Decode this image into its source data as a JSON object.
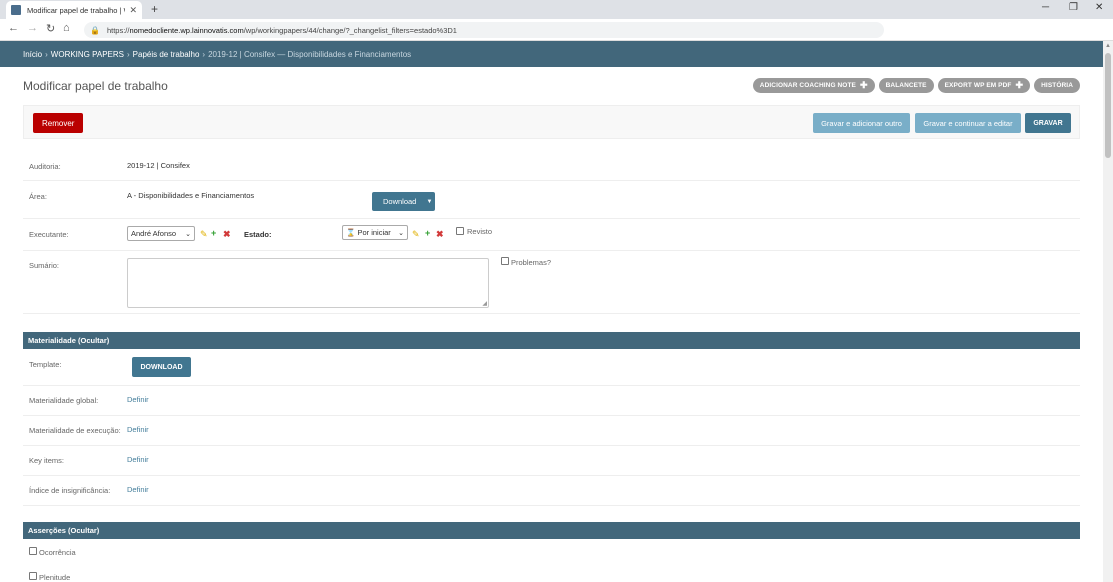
{
  "browser": {
    "tab_title": "Modificar papel de trabalho | W...",
    "url_host": "nomedocliente.wp.lainnovatis.com",
    "url_prefix": "https://",
    "url_path": "/wp/workingpapers/44/change/?_changelist_filters=estado%3D1"
  },
  "breadcrumb": {
    "home": "Início",
    "app": "WORKING PAPERS",
    "model": "Papéis de trabalho",
    "current": "2019-12 | Consifex — Disponibilidades e Financiamentos",
    "sep": "›"
  },
  "page_title": "Modificar papel de trabalho",
  "object_tools": {
    "coaching": "Adicionar coaching note",
    "balancete": "Balancete",
    "export": "Export WP em PDF",
    "historia": "História"
  },
  "submit_row": {
    "remove": "Remover",
    "save_add": "Gravar e adicionar outro",
    "save_continue": "Gravar e continuar a editar",
    "save": "GRAVAR"
  },
  "form": {
    "auditoria_label": "Auditoria:",
    "auditoria_value": "2019-12 | Consifex",
    "area_label": "Área:",
    "area_value": "A - Disponibilidades e Financiamentos",
    "download_split": "Download",
    "executante_label": "Executante:",
    "executante_value": "André Afonso",
    "estado_label": "Estado:",
    "estado_value": "Por iniciar",
    "revisto_label": "Revisto",
    "sumario_label": "Sumário:",
    "problemas_label": "Problemas?"
  },
  "materialidade": {
    "header": "Materialidade (Ocultar)",
    "template_label": "Template:",
    "download_button": "DOWNLOAD",
    "global_label": "Materialidade global:",
    "execucao_label": "Materialidade de execução:",
    "key_items_label": "Key items:",
    "insignificancia_label": "Índice de insignificância:",
    "definir": "Definir"
  },
  "assercoes": {
    "header": "Asserções (Ocultar)",
    "ocorrencia": "Ocorrência",
    "plenitude": "Plenitude"
  }
}
